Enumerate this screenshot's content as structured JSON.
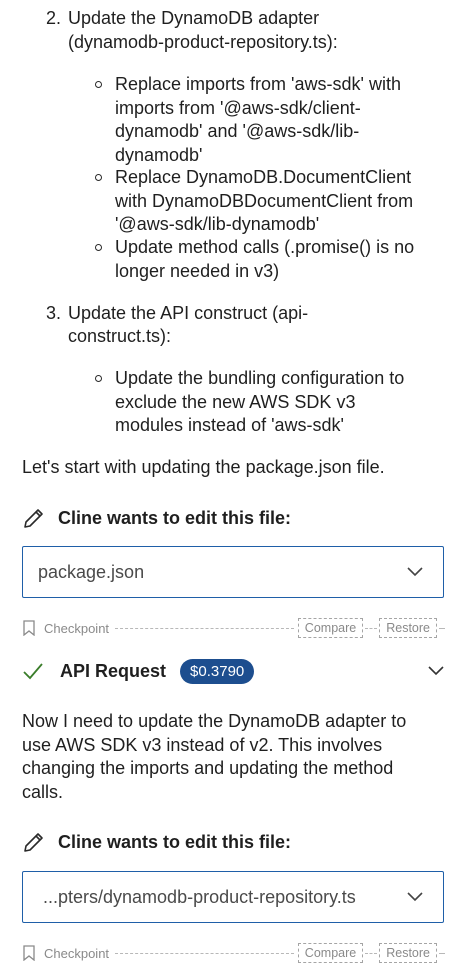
{
  "plan": {
    "step2": {
      "number": "2.",
      "lines": [
        "Update the DynamoDB adapter",
        "(dynamodb-product-repository.ts):"
      ],
      "bullets": [
        [
          "Replace imports from 'aws-sdk' with",
          "imports from '@aws-sdk/client-",
          "dynamodb' and '@aws-sdk/lib-",
          "dynamodb'"
        ],
        [
          "Replace DynamoDB.DocumentClient",
          "with DynamoDBDocumentClient from",
          "'@aws-sdk/lib-dynamodb'"
        ],
        [
          "Update method calls (.promise() is no",
          "longer needed in v3)"
        ]
      ]
    },
    "step3": {
      "number": "3.",
      "lines": [
        "Update the API construct (api-",
        "construct.ts):"
      ],
      "bullets": [
        [
          "Update the bundling configuration to",
          "exclude the new AWS SDK v3",
          "modules instead of 'aws-sdk'"
        ]
      ]
    }
  },
  "intro_text": "Let's start with updating the package.json file.",
  "edit1": {
    "header": "Cline wants to edit this file:",
    "filename": "package.json"
  },
  "checkpoint1": {
    "label": "Checkpoint",
    "compare": "Compare",
    "restore": "Restore"
  },
  "api_request": {
    "title": "API Request",
    "cost": "$0.3790"
  },
  "message_lines": [
    "Now I need to update the DynamoDB adapter to",
    "use AWS SDK v3 instead of v2. This involves",
    "changing the imports and updating the method",
    "calls."
  ],
  "edit2": {
    "header": "Cline wants to edit this file:",
    "filename": "...pters/dynamodb-product-repository.ts"
  },
  "checkpoint2": {
    "label": "Checkpoint",
    "compare": "Compare",
    "restore": "Restore"
  },
  "colors": {
    "accent": "#1d4e8f",
    "border": "#1f5fa8",
    "success": "#3a7d2a"
  }
}
